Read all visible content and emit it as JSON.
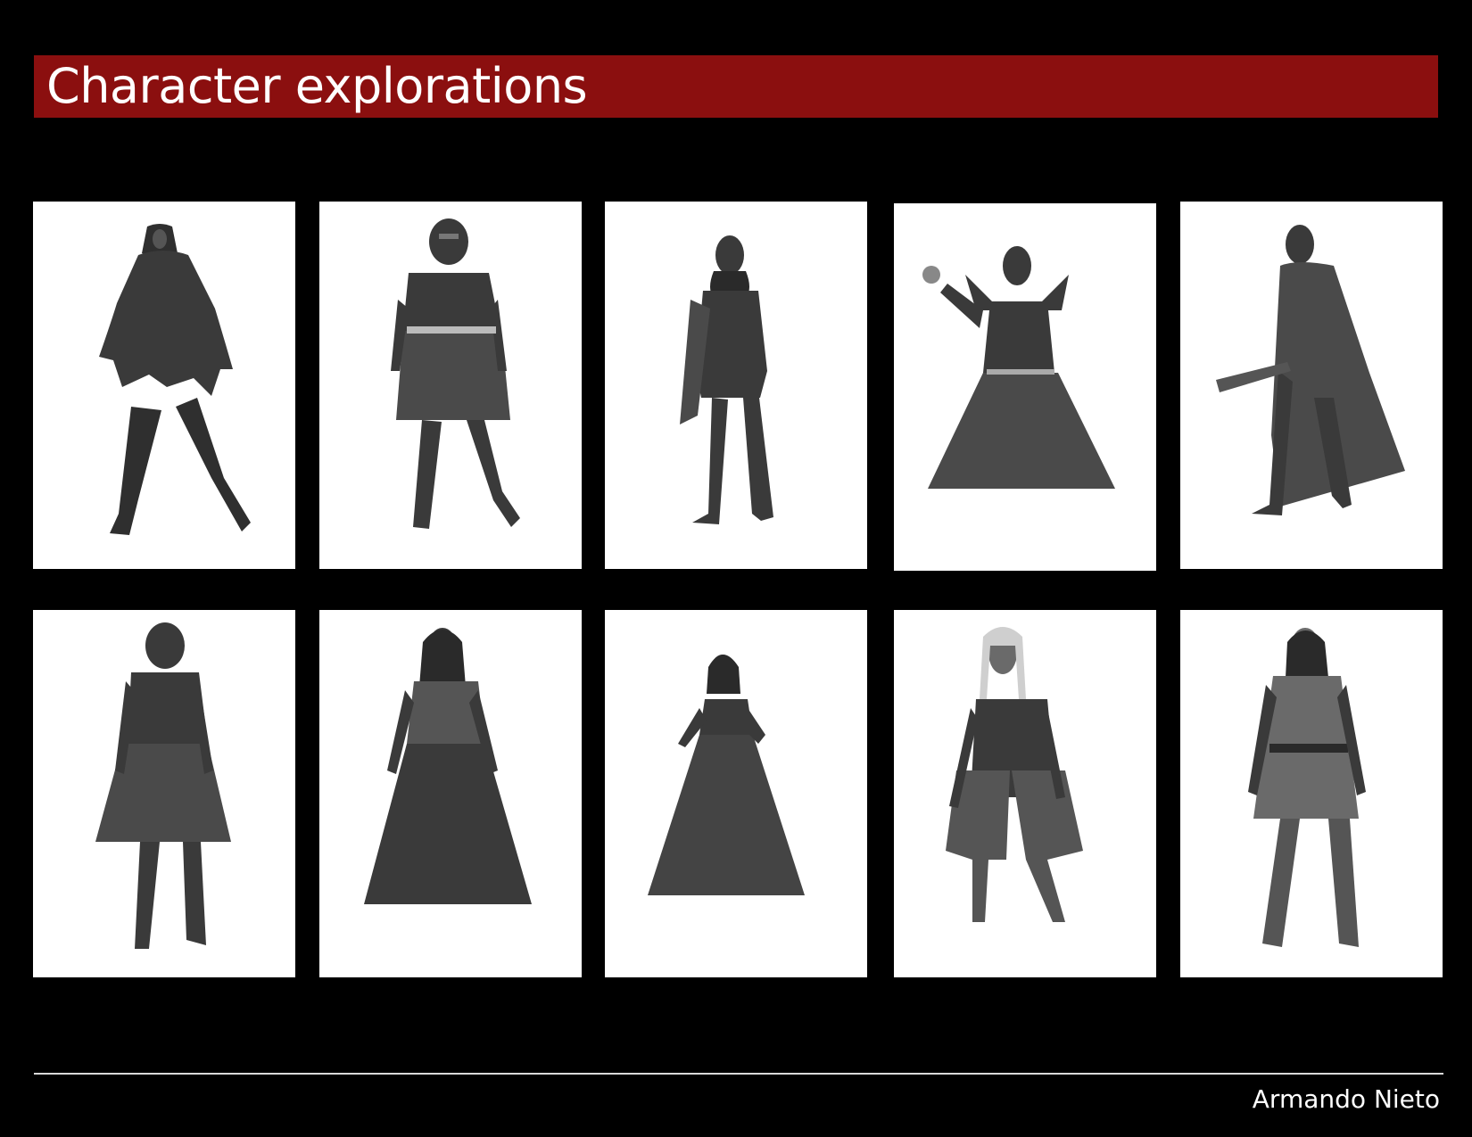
{
  "header": {
    "title": "Character explorations"
  },
  "footer": {
    "author": "Armando Nieto"
  },
  "gallery": {
    "cards": [
      {
        "name": "hooded-tattered-figure"
      },
      {
        "name": "armored-knight-skirt"
      },
      {
        "name": "caped-woman"
      },
      {
        "name": "sorcerer-flame-hand"
      },
      {
        "name": "caped-gunner"
      },
      {
        "name": "knight-fringed-skirt"
      },
      {
        "name": "woman-long-skirt"
      },
      {
        "name": "woman-ball-gown"
      },
      {
        "name": "white-haired-figure"
      },
      {
        "name": "tunic-boots-figure"
      }
    ]
  }
}
